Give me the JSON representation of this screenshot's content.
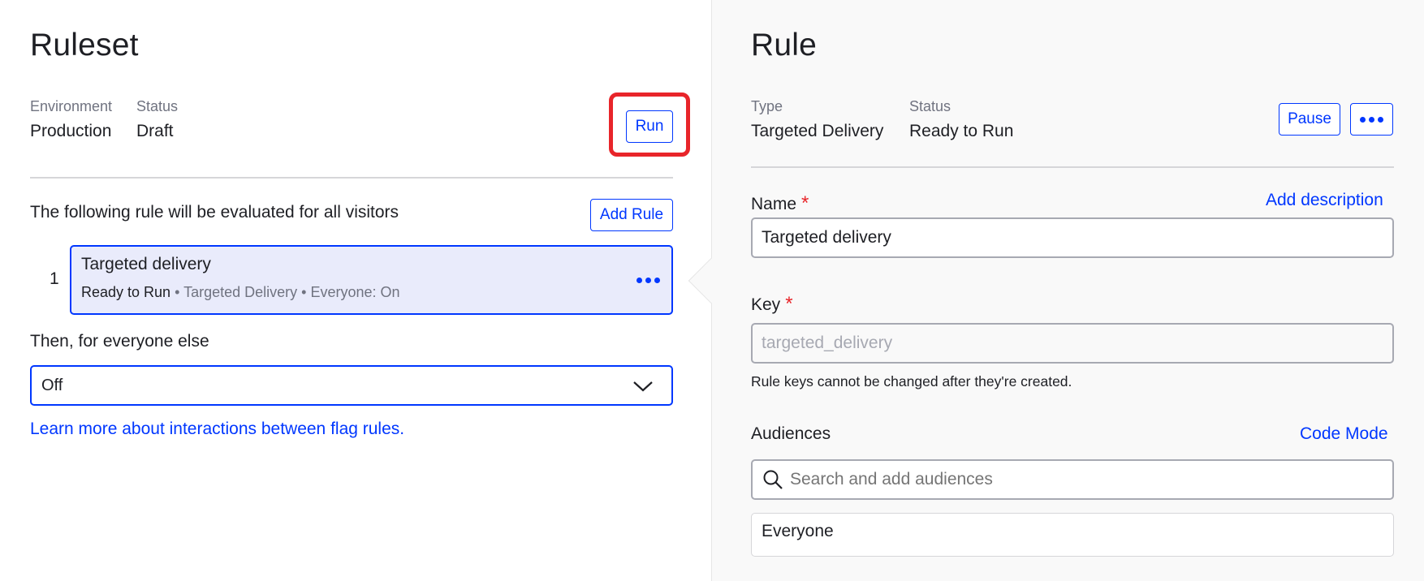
{
  "ruleset": {
    "title": "Ruleset",
    "environment_label": "Environment",
    "environment_value": "Production",
    "status_label": "Status",
    "status_value": "Draft",
    "run_label": "Run",
    "intro_text": "The following rule will be evaluated for all visitors",
    "add_rule_label": "Add Rule",
    "rules": [
      {
        "index": "1",
        "name": "Targeted delivery",
        "status": "Ready to Run",
        "details": "• Targeted Delivery • Everyone: On"
      }
    ],
    "fallback_label": "Then, for everyone else",
    "fallback_value": "Off",
    "learn_more_link": "Learn more about interactions between flag rules."
  },
  "rule": {
    "title": "Rule",
    "type_label": "Type",
    "type_value": "Targeted Delivery",
    "status_label": "Status",
    "status_value": "Ready to Run",
    "pause_label": "Pause",
    "name_label": "Name",
    "required_mark": "*",
    "add_description_link": "Add description",
    "name_value": "Targeted delivery",
    "key_label": "Key",
    "key_value": "targeted_delivery",
    "key_helper": "Rule keys cannot be changed after they're created.",
    "audiences_label": "Audiences",
    "code_mode_link": "Code Mode",
    "audience_search_placeholder": "Search and add audiences",
    "audiences": [
      "Everyone"
    ]
  },
  "colors": {
    "accent": "#0037ff",
    "highlight": "#e8252a",
    "selected_card_bg": "#e9ebfb"
  }
}
